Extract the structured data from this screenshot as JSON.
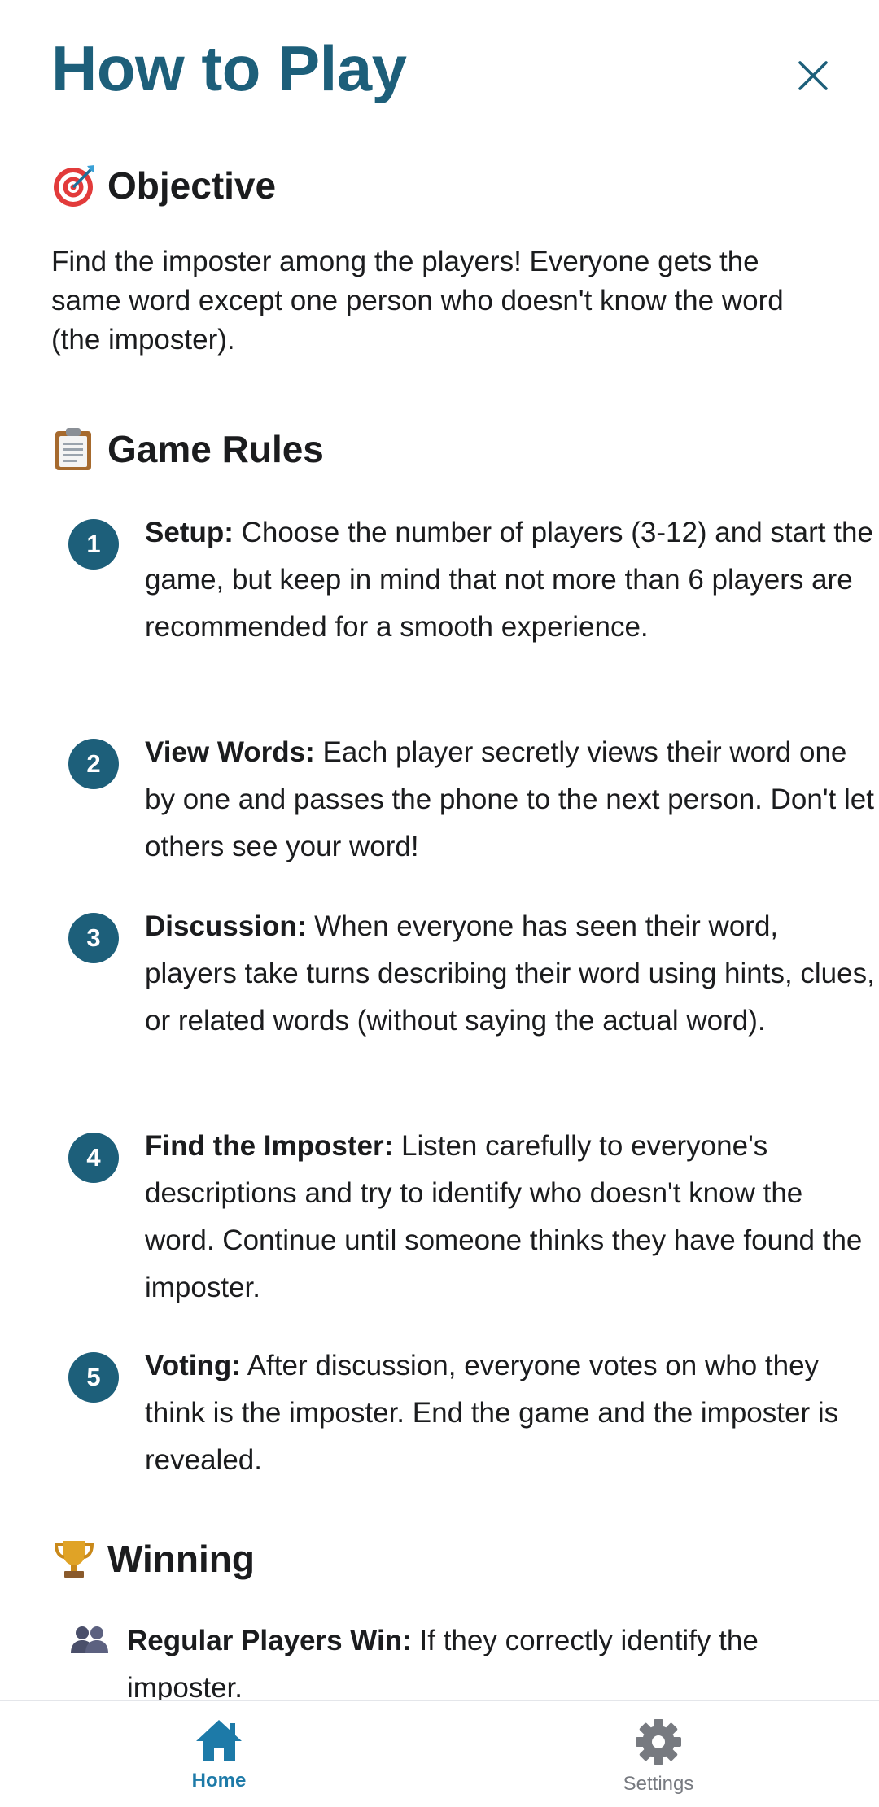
{
  "header": {
    "title": "How to Play"
  },
  "objective": {
    "heading": "Objective",
    "icon": "target-icon",
    "text": "Find the imposter among the players! Everyone gets the same word except one person who doesn't know the word (the imposter)."
  },
  "rules": {
    "heading": "Game Rules",
    "icon": "clipboard-icon",
    "items": [
      {
        "number": "1",
        "title": "Setup:",
        "text": " Choose the number of players (3-12) and start the game, but keep in mind that not more than 6 players are recommended for a smooth experience."
      },
      {
        "number": "2",
        "title": "View Words:",
        "text": " Each player secretly views their word one by one and passes the phone to the next person. Don't let others see your word!"
      },
      {
        "number": "3",
        "title": "Discussion:",
        "text": " When everyone has seen their word, players take turns describing their word using hints, clues, or related words (without saying the actual word)."
      },
      {
        "number": "4",
        "title": "Find the Imposter:",
        "text": " Listen carefully to everyone's descriptions and try to identify who doesn't know the word. Continue until someone thinks they have found the imposter."
      },
      {
        "number": "5",
        "title": "Voting:",
        "text": " After discussion, everyone votes on who they think is the imposter. End the game and the imposter is revealed."
      }
    ]
  },
  "winning": {
    "heading": "Winning",
    "icon": "trophy-icon",
    "items": [
      {
        "icon": "people-icon",
        "title": "Regular Players Win:",
        "text": " If they correctly identify the imposter."
      }
    ]
  },
  "nav": {
    "home_label": "Home",
    "settings_label": "Settings"
  },
  "colors": {
    "accent": "#1d5f7a",
    "nav_active": "#1d7aa8",
    "nav_inactive": "#777a80"
  }
}
